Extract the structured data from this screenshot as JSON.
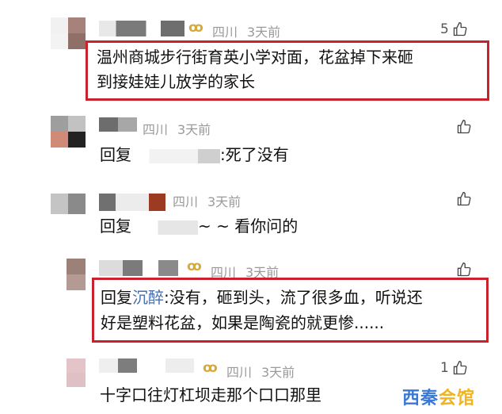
{
  "comments": [
    {
      "location": "四川",
      "time": "3天前",
      "likes": "5",
      "body_line1": "温州商城步行街育英小学对面，花盆掉下来砸",
      "body_line2": "到接娃娃儿放学的家长"
    },
    {
      "location": "四川",
      "time": "3天前",
      "likes": "",
      "reply_prefix": "回复",
      "body": ":死了没有"
    },
    {
      "location": "四川",
      "time": "3天前",
      "likes": "",
      "reply_prefix": "回复",
      "body": "~ ~ 看你问的"
    },
    {
      "location": "四川",
      "time": "3天前",
      "likes": "",
      "reply_prefix": "回复",
      "reply_target": "沉醉",
      "body_line1": ":没有，砸到头，流了很多血，听说还",
      "body_line2": "好是塑料花盆，如果是陶瓷的就更惨......"
    },
    {
      "location": "四川",
      "time": "3天前",
      "likes": "1",
      "body": "十字口往灯杠坝走那个口口那里"
    }
  ],
  "watermark": {
    "part1": "西秦",
    "part2": "会馆"
  },
  "colors": {
    "highlight_box": "#c8232c",
    "link": "#4a6ea8",
    "meta": "#9a9a9a",
    "vip_badge": "#d6a93b"
  },
  "icons": [
    "thumbs-up-icon",
    "vip-badge-icon"
  ]
}
